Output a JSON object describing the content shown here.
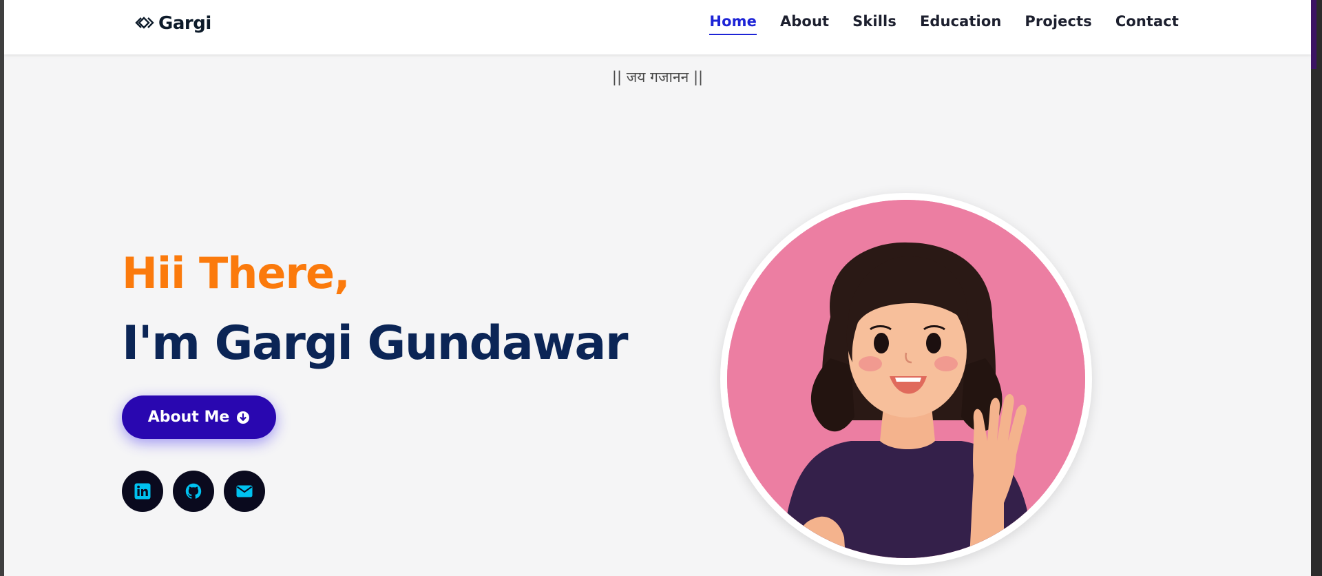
{
  "brand": {
    "name": "Gargi",
    "icon": "diamond-code-icon"
  },
  "nav": {
    "items": [
      {
        "label": "Home",
        "active": true
      },
      {
        "label": "About",
        "active": false
      },
      {
        "label": "Skills",
        "active": false
      },
      {
        "label": "Education",
        "active": false
      },
      {
        "label": "Projects",
        "active": false
      },
      {
        "label": "Contact",
        "active": false
      }
    ]
  },
  "hero": {
    "tagline": "|| जय गजानन ||",
    "greeting": "Hii There,",
    "name": "I'm Gargi Gundawar",
    "cta_label": "About Me",
    "cta_icon": "arrow-circle-down-icon"
  },
  "socials": [
    {
      "name": "linkedin",
      "icon": "linkedin-icon"
    },
    {
      "name": "github",
      "icon": "github-icon"
    },
    {
      "name": "email",
      "icon": "envelope-icon"
    }
  ],
  "colors": {
    "accent_orange": "#fb7a0c",
    "navy": "#0b2556",
    "button": "#2907b0",
    "nav_active": "#1d24d6",
    "social_bg": "#0a0a1e",
    "social_icon": "#00c2f0",
    "avatar_bg": "#ec7ea2"
  }
}
